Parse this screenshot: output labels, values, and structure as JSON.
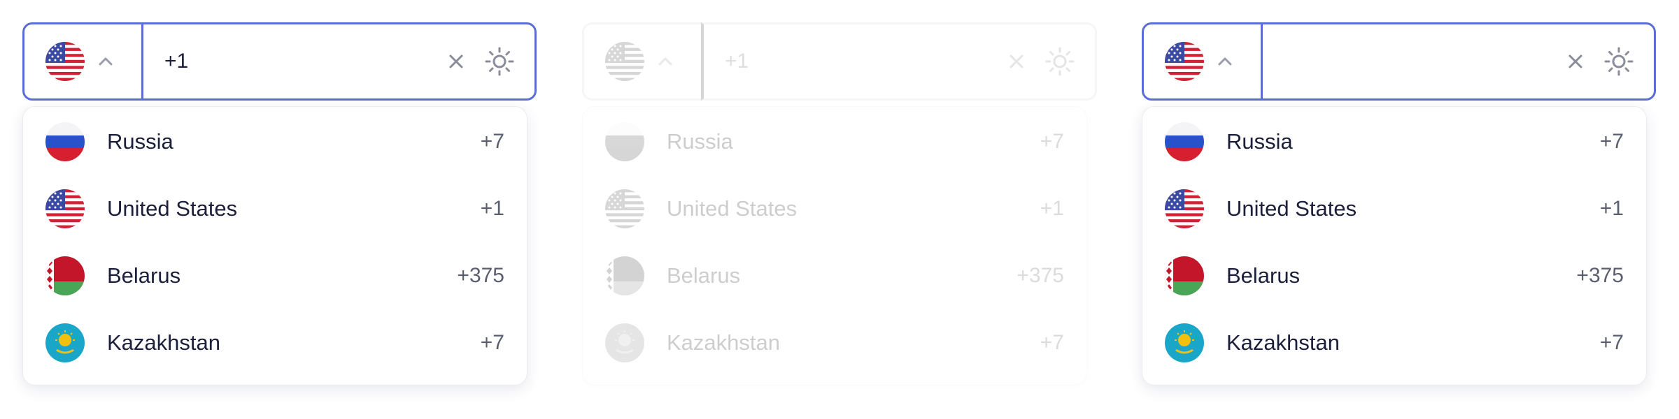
{
  "widgets": [
    {
      "phone_value": "+1",
      "state": "focused-open"
    },
    {
      "phone_value": "+1",
      "state": "disabled-error"
    },
    {
      "phone_value": "",
      "state": "focused-open-empty"
    }
  ],
  "countries": [
    {
      "name": "Russia",
      "code": "+7",
      "flag": "russia-flag-icon"
    },
    {
      "name": "United States",
      "code": "+1",
      "flag": "us-flag-icon"
    },
    {
      "name": "Belarus",
      "code": "+375",
      "flag": "belarus-flag-icon"
    },
    {
      "name": "Kazakhstan",
      "code": "+7",
      "flag": "kazakhstan-flag-icon"
    }
  ],
  "colors": {
    "accent": "#5b6ed4",
    "error": "#e0241b",
    "text": "#1b1f3b",
    "muted": "#5a5e6e"
  },
  "icons": {
    "selected_flag": "us-flag-icon",
    "chevron": "chevron-up-icon",
    "clear": "close-icon",
    "theme": "sun-icon"
  }
}
